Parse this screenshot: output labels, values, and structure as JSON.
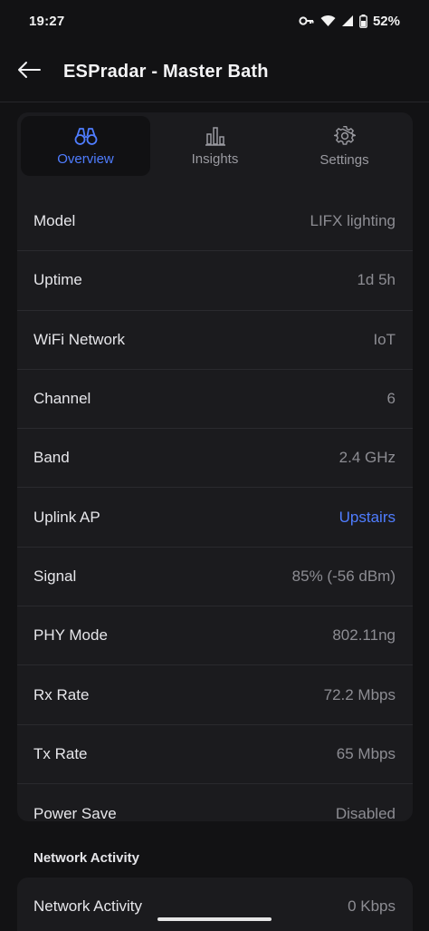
{
  "status_bar": {
    "time": "19:27",
    "battery": "52%",
    "icons": [
      "key-icon",
      "wifi-icon",
      "cell-signal-icon",
      "battery-icon"
    ]
  },
  "app_bar": {
    "title": "ESPradar - Master Bath",
    "back_icon": "arrow-left-icon"
  },
  "tabs": [
    {
      "label": "Overview",
      "icon": "binoculars-icon",
      "active": true
    },
    {
      "label": "Insights",
      "icon": "bar-chart-icon",
      "active": false
    },
    {
      "label": "Settings",
      "icon": "gear-icon",
      "active": false
    }
  ],
  "details": [
    {
      "label": "Model",
      "value": "LIFX lighting"
    },
    {
      "label": "Uptime",
      "value": "1d 5h"
    },
    {
      "label": "WiFi Network",
      "value": "IoT"
    },
    {
      "label": "Channel",
      "value": "6"
    },
    {
      "label": "Band",
      "value": "2.4 GHz"
    },
    {
      "label": "Uplink AP",
      "value": "Upstairs"
    },
    {
      "label": "Signal",
      "value": "85% (-56 dBm)"
    },
    {
      "label": "PHY Mode",
      "value": "802.11ng"
    },
    {
      "label": "Rx Rate",
      "value": "72.2 Mbps"
    },
    {
      "label": "Tx Rate",
      "value": "65 Mbps"
    },
    {
      "label": "Power Save",
      "value": "Disabled"
    }
  ],
  "network_activity": {
    "section_title": "Network Activity",
    "row": {
      "label": "Network Activity",
      "value": "0 Kbps"
    }
  },
  "colors": {
    "accent": "#4f7dff",
    "background": "#121214",
    "card": "#1b1b1e"
  }
}
